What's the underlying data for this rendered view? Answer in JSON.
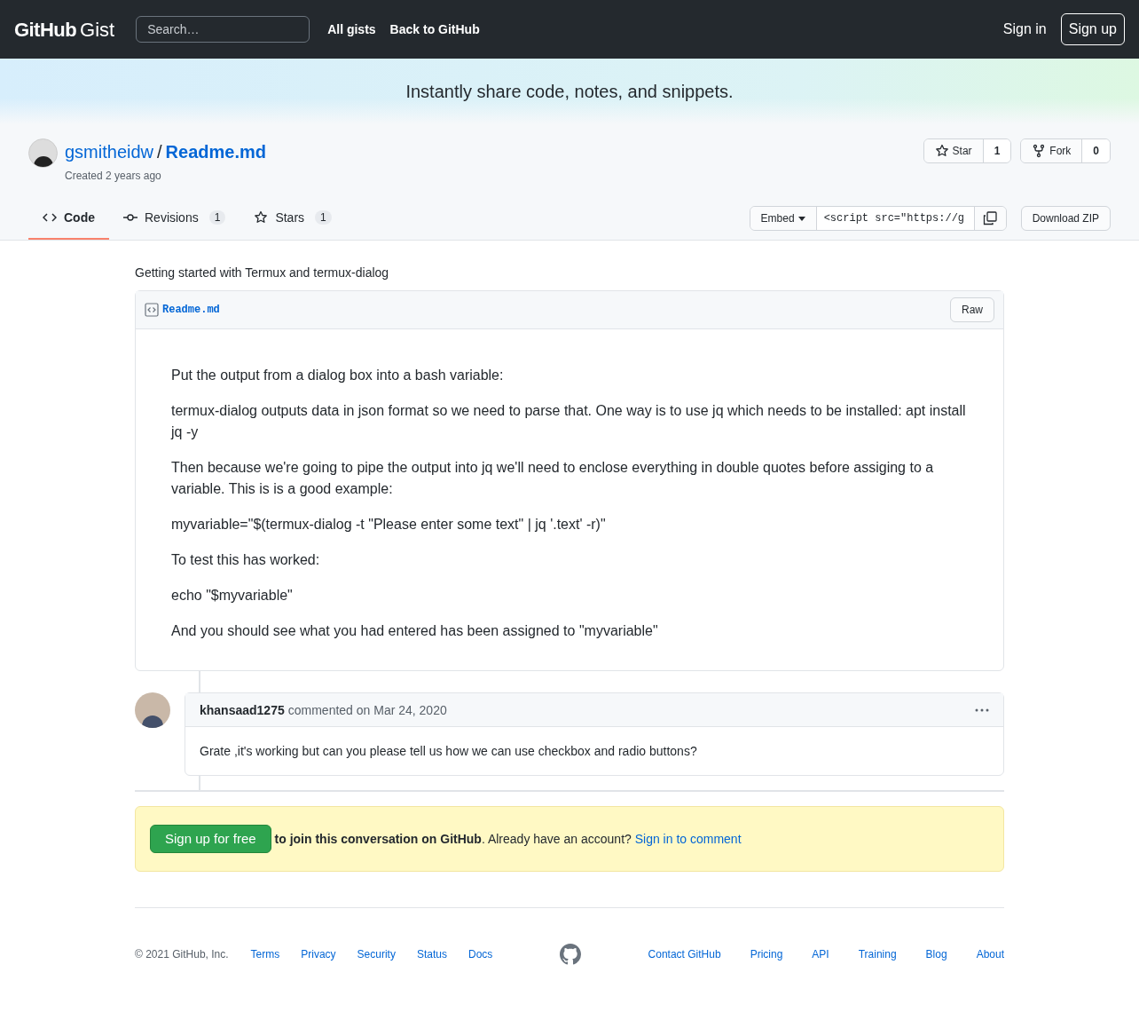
{
  "header": {
    "logo": "GitHub",
    "logo_suffix": "Gist",
    "search": {
      "placeholder": "Search…"
    },
    "nav": [
      "All gists",
      "Back to GitHub"
    ],
    "sign_in": "Sign in",
    "sign_up": "Sign up"
  },
  "hero": "Instantly share code, notes, and snippets.",
  "gist": {
    "owner": "gsmitheidw",
    "separator": "/",
    "name": "Readme.md",
    "created": "Created 2 years ago",
    "actions": [
      {
        "kind": "star",
        "label": "Star",
        "count": "1"
      },
      {
        "kind": "fork",
        "label": "Fork",
        "count": "0"
      }
    ],
    "tabs": [
      {
        "kind": "code",
        "label": "Code",
        "selected": true
      },
      {
        "kind": "revisions",
        "label": "Revisions",
        "count": "1",
        "selected": false
      },
      {
        "kind": "stars",
        "label": "Stars",
        "count": "1",
        "selected": false
      }
    ],
    "embed": {
      "label": "Embed",
      "value": "<script src=\"https://g"
    },
    "download": "Download ZIP"
  },
  "description": "Getting started with Termux and termux-dialog",
  "file": {
    "name": "Readme.md",
    "raw": "Raw",
    "paragraphs": [
      "Put the output from a dialog box into a bash variable:",
      "termux-dialog outputs data in json format so we need to parse that. One way is to use jq which needs to be installed: apt install jq -y",
      "Then because we're going to pipe the output into jq we'll need to enclose everything in double quotes before assiging to a variable. This is is a good example:",
      "myvariable=\"$(termux-dialog -t \"Please enter some text\" | jq '.text' -r)\"",
      "To test this has worked:",
      "echo \"$myvariable\"",
      "And you should see what you had entered has been assigned to \"myvariable\""
    ]
  },
  "comment": {
    "author": "khansaad1275",
    "meta": "commented on Mar 24, 2020",
    "body": "Grate ,it's working but can you please tell us how we can use checkbox and radio buttons?"
  },
  "join": {
    "button": "Sign up for free",
    "text": "**to join this conversation on GitHub**. Already have an account?",
    "link": "Sign in to comment"
  },
  "footer": {
    "copyright": "© 2021 GitHub, Inc.",
    "left_links": [
      "Terms",
      "Privacy",
      "Security",
      "Status",
      "Docs"
    ],
    "right_links": [
      "Contact GitHub",
      "Pricing",
      "API",
      "Training",
      "Blog",
      "About"
    ]
  }
}
